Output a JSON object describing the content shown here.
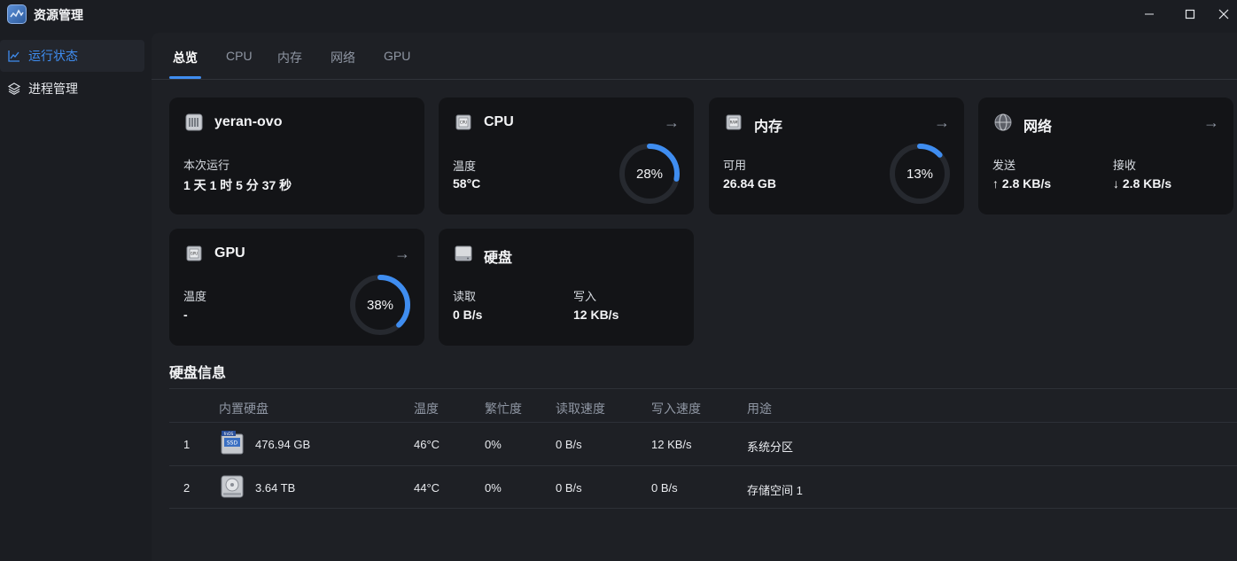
{
  "window": {
    "title": "资源管理",
    "minimize": "—",
    "maximize": "☐",
    "close": "✕"
  },
  "sidebar": {
    "items": [
      {
        "label": "运行状态",
        "icon": "chart-line-icon",
        "active": true
      },
      {
        "label": "进程管理",
        "icon": "layers-icon",
        "active": false
      }
    ]
  },
  "tabs": [
    "总览",
    "CPU",
    "内存",
    "网络",
    "GPU"
  ],
  "cards": {
    "host": {
      "title": "yeran-ovo",
      "uptime_label": "本次运行",
      "uptime": "1 天 1 时 5 分 37 秒"
    },
    "cpu": {
      "title": "CPU",
      "temp_label": "温度",
      "temp": "58°C",
      "usage": 28,
      "usage_text": "28%"
    },
    "memory": {
      "title": "内存",
      "avail_label": "可用",
      "avail": "26.84 GB",
      "usage": 13,
      "usage_text": "13%"
    },
    "network": {
      "title": "网络",
      "send_label": "发送",
      "send": "↑ 2.8 KB/s",
      "recv_label": "接收",
      "recv": "↓ 2.8 KB/s"
    },
    "gpu": {
      "title": "GPU",
      "temp_label": "温度",
      "temp": "-",
      "usage": 38,
      "usage_text": "38%"
    },
    "disk": {
      "title": "硬盘",
      "read_label": "读取",
      "read": "0 B/s",
      "write_label": "写入",
      "write": "12 KB/s"
    }
  },
  "disk_info": {
    "title": "硬盘信息",
    "headers": [
      "内置硬盘",
      "温度",
      "繁忙度",
      "读取速度",
      "写入速度",
      "用途"
    ],
    "rows": [
      {
        "index": "1",
        "size": "476.94 GB",
        "temp": "46°C",
        "busy": "0%",
        "read": "0 B/s",
        "write": "12 KB/s",
        "usage": "系统分区",
        "icon": "ssd-icon"
      },
      {
        "index": "2",
        "size": "3.64 TB",
        "temp": "44°C",
        "busy": "0%",
        "read": "0 B/s",
        "write": "0 B/s",
        "usage": "存储空间 1",
        "icon": "hdd-icon"
      }
    ]
  },
  "colors": {
    "accent": "#3f8df0",
    "card_bg": "#131417",
    "page_bg": "#1b1d22"
  }
}
